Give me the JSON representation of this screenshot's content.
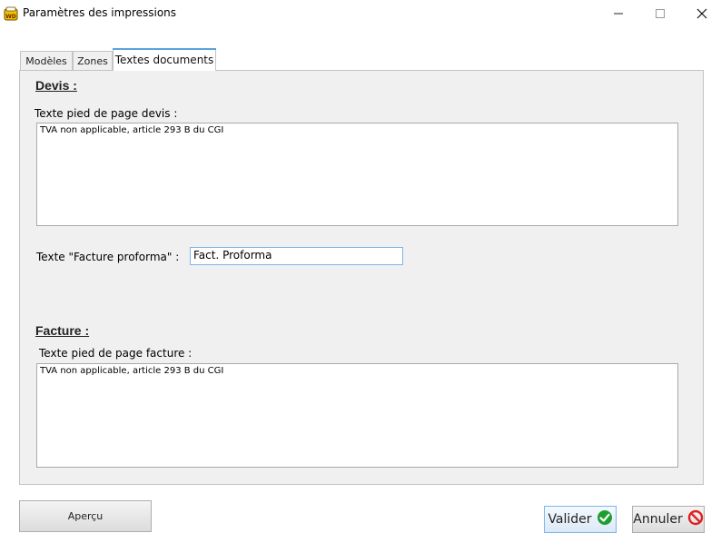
{
  "window": {
    "title": "Paramètres des impressions",
    "minimize_glyph": "—",
    "maximize_glyph": "☐",
    "close_glyph": "✕"
  },
  "tabs": [
    {
      "label": "Modèles",
      "active": false
    },
    {
      "label": "Zones",
      "active": false
    },
    {
      "label": "Textes documents",
      "active": true
    }
  ],
  "devis": {
    "section_title": "Devis :",
    "footer_label": "Texte pied de page devis :",
    "footer_value": "TVA non applicable, article 293 B du CGI",
    "proforma_label": "Texte \"Facture proforma\" :",
    "proforma_value": "Fact. Proforma"
  },
  "facture": {
    "section_title": "Facture :",
    "footer_label": "Texte pied de page facture :",
    "footer_value": "TVA non applicable, article 293 B du CGI"
  },
  "buttons": {
    "apercu": "Aperçu",
    "valider": "Valider",
    "annuler": "Annuler"
  },
  "icons": {
    "app": "windev-app-icon",
    "valider": "check-icon",
    "annuler": "cancel-icon"
  },
  "colors": {
    "active_tab_accent": "#5ba3dc",
    "focus_border": "#7eb4ea",
    "check_green": "#1e9e2f",
    "cancel_red": "#e02020"
  }
}
